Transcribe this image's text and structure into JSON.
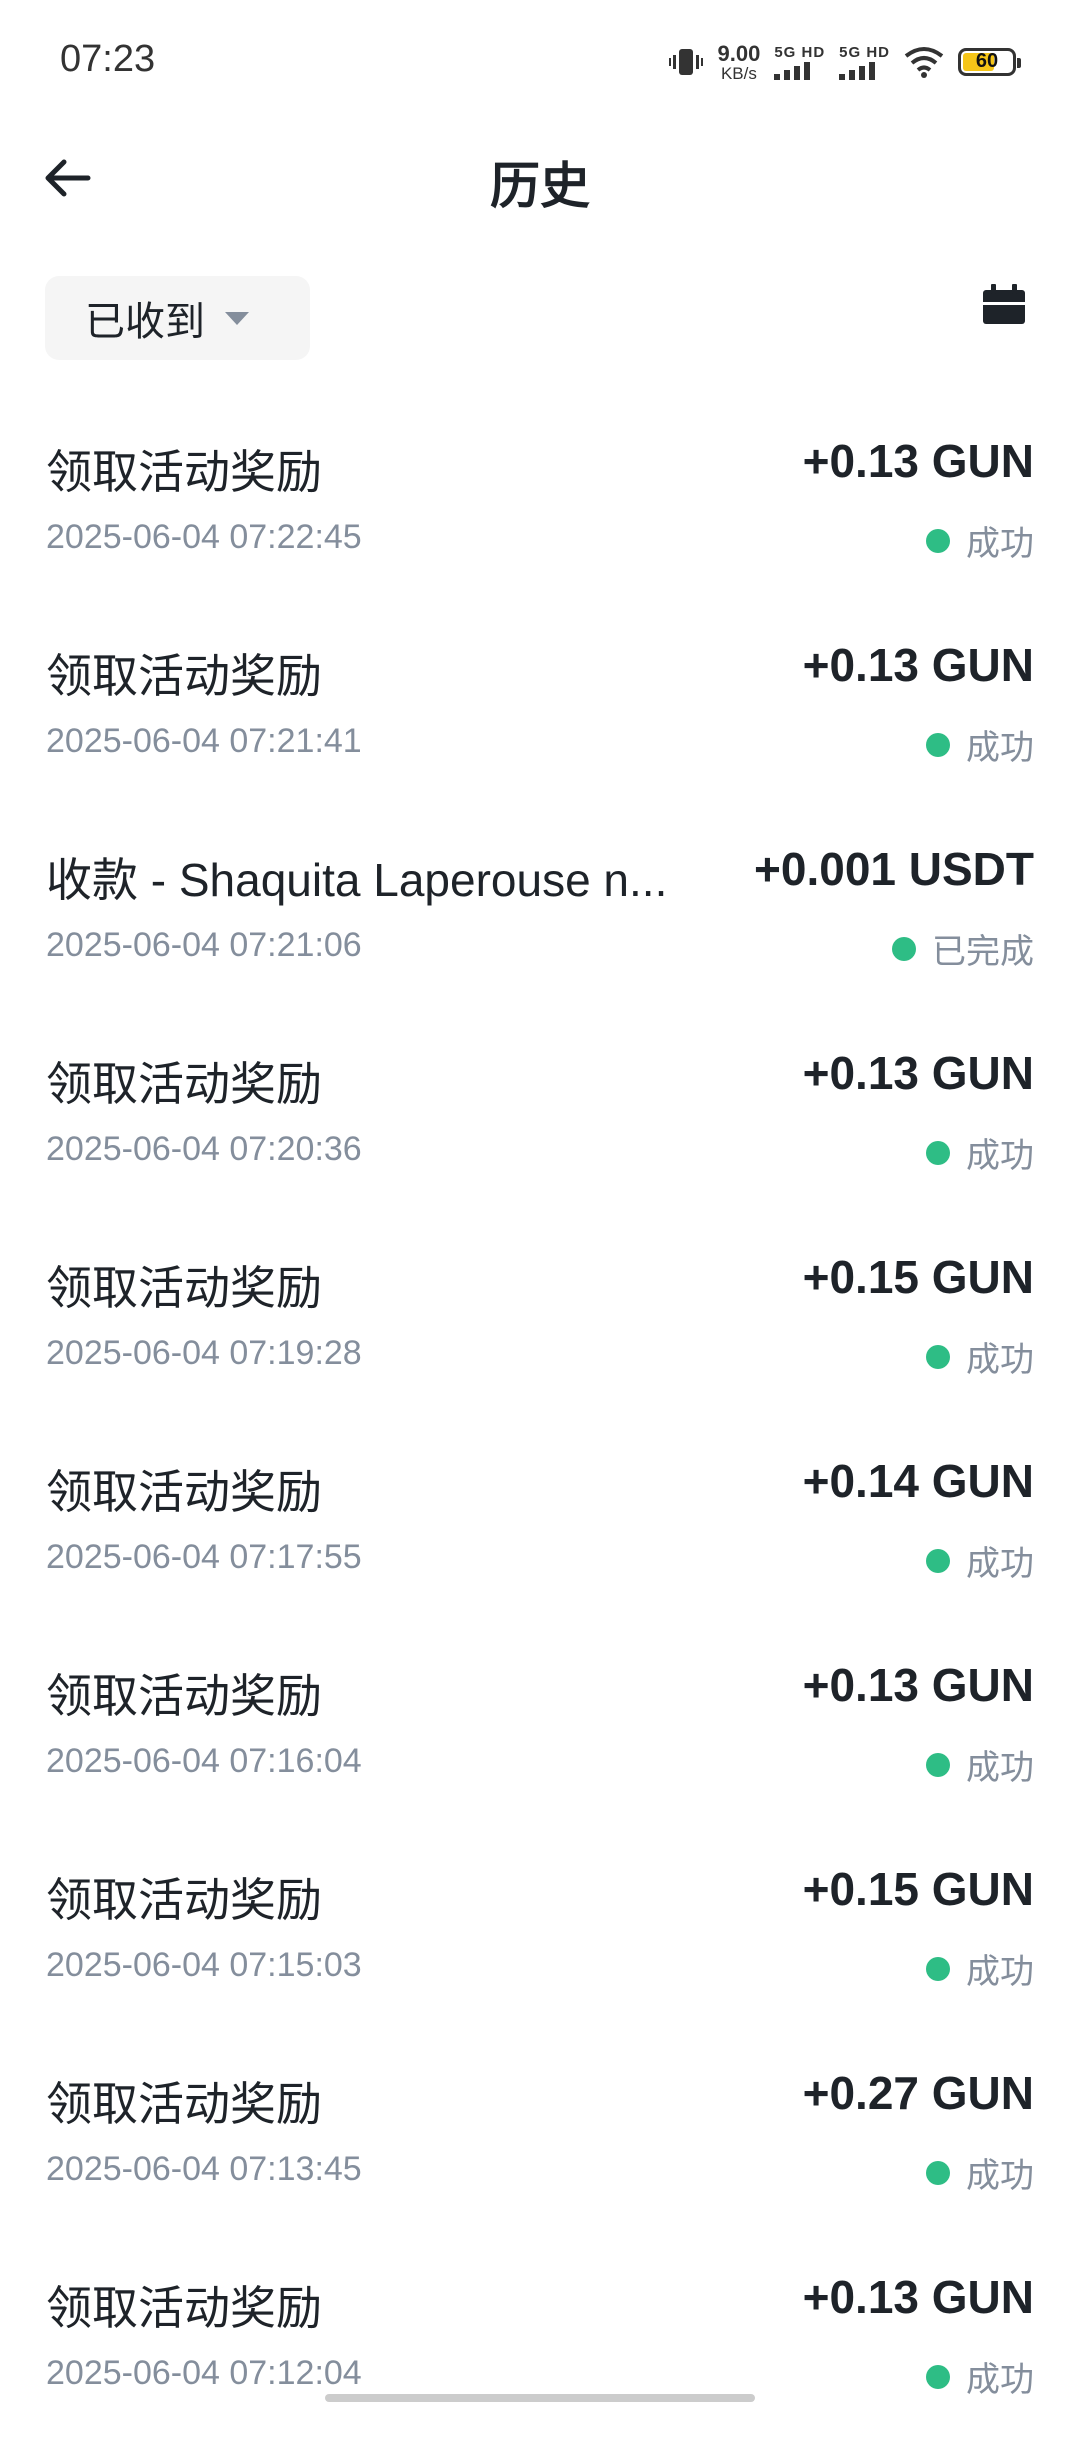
{
  "status_bar": {
    "time": "07:23",
    "net_speed_value": "9.00",
    "net_speed_unit": "KB/s",
    "sim1_label": "5G HD",
    "sim2_label": "5G HD",
    "battery_level": "60",
    "icons": [
      "vibrate-icon",
      "signal-icon",
      "wifi-icon",
      "battery-icon"
    ]
  },
  "header": {
    "title": "历史",
    "back_icon": "arrow-left-icon"
  },
  "filter": {
    "selected": "已收到",
    "calendar_icon": "calendar-icon"
  },
  "colors": {
    "success_dot": "#2ebd85",
    "muted_text": "#848e9c",
    "primary_text": "#1e2329"
  },
  "history": [
    {
      "title": "领取活动奖励",
      "time": "2025-06-04 07:22:45",
      "amount": "+0.13 GUN",
      "status": "成功"
    },
    {
      "title": "领取活动奖励",
      "time": "2025-06-04 07:21:41",
      "amount": "+0.13 GUN",
      "status": "成功"
    },
    {
      "title": "收款 - Shaquita Laperouse n...",
      "time": "2025-06-04 07:21:06",
      "amount": "+0.001 USDT",
      "status": "已完成"
    },
    {
      "title": "领取活动奖励",
      "time": "2025-06-04 07:20:36",
      "amount": "+0.13 GUN",
      "status": "成功"
    },
    {
      "title": "领取活动奖励",
      "time": "2025-06-04 07:19:28",
      "amount": "+0.15 GUN",
      "status": "成功"
    },
    {
      "title": "领取活动奖励",
      "time": "2025-06-04 07:17:55",
      "amount": "+0.14 GUN",
      "status": "成功"
    },
    {
      "title": "领取活动奖励",
      "time": "2025-06-04 07:16:04",
      "amount": "+0.13 GUN",
      "status": "成功"
    },
    {
      "title": "领取活动奖励",
      "time": "2025-06-04 07:15:03",
      "amount": "+0.15 GUN",
      "status": "成功"
    },
    {
      "title": "领取活动奖励",
      "time": "2025-06-04 07:13:45",
      "amount": "+0.27 GUN",
      "status": "成功"
    },
    {
      "title": "领取活动奖励",
      "time": "2025-06-04 07:12:04",
      "amount": "+0.13 GUN",
      "status": "成功"
    }
  ]
}
